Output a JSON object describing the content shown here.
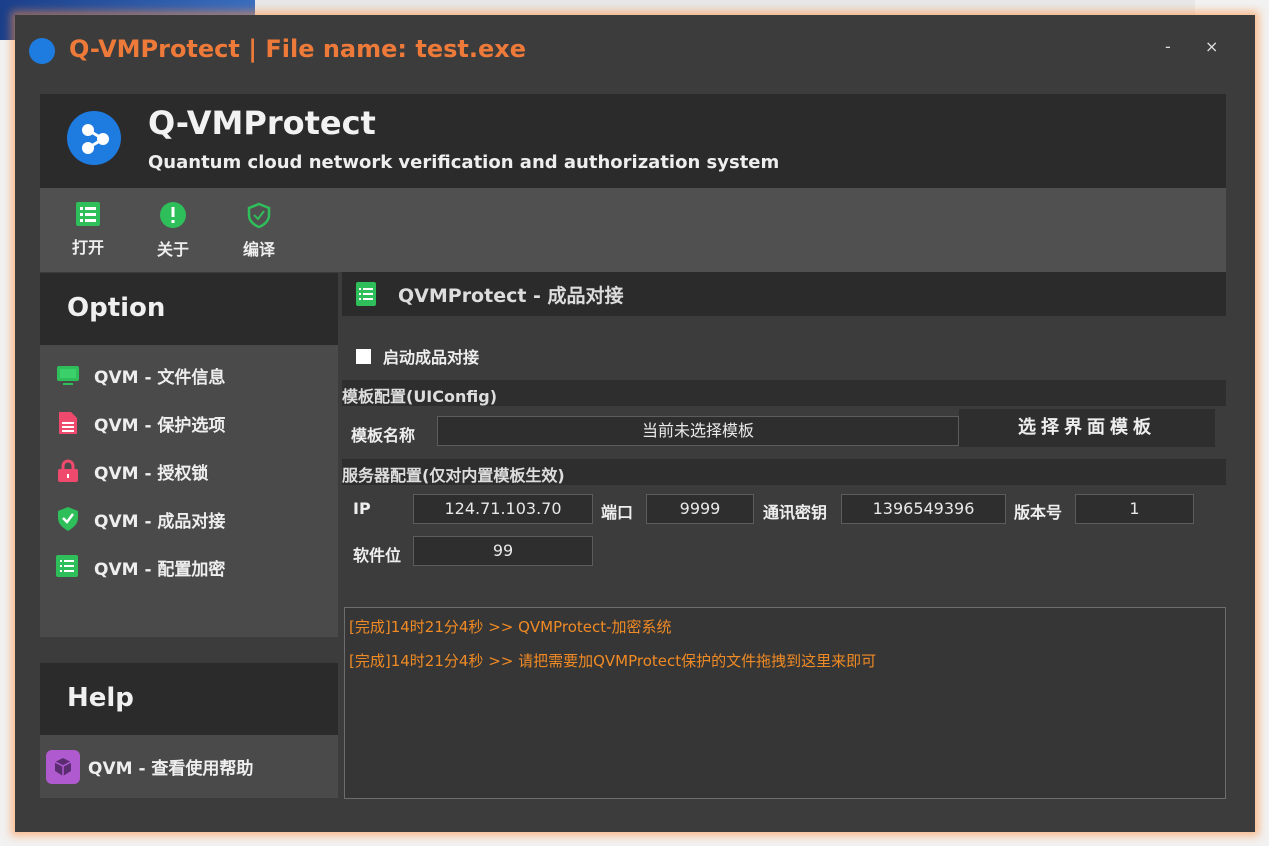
{
  "window": {
    "title": "Q-VMProtect | File name: test.exe",
    "minimize": "-",
    "close": "×"
  },
  "header": {
    "title": "Q-VMProtect",
    "subtitle": "Quantum cloud network verification and authorization system"
  },
  "toolbar": [
    {
      "label": "打开",
      "icon": "list-icon"
    },
    {
      "label": "关于",
      "icon": "alert-icon"
    },
    {
      "label": "编译",
      "icon": "shield-check-icon"
    }
  ],
  "sidebar": {
    "option_title": "Option",
    "items": [
      {
        "label": "QVM - 文件信息",
        "icon": "monitor-icon",
        "color": "#2fbf5a"
      },
      {
        "label": "QVM - 保护选项",
        "icon": "document-icon",
        "color": "#ef4a6e"
      },
      {
        "label": "QVM - 授权锁",
        "icon": "lock-icon",
        "color": "#ef4a6e"
      },
      {
        "label": "QVM - 成品对接",
        "icon": "shield-check-icon",
        "color": "#2fbf5a"
      },
      {
        "label": "QVM - 配置加密",
        "icon": "list-icon",
        "color": "#2fbf5a"
      }
    ],
    "help_title": "Help",
    "help_item": "QVM - 查看使用帮助"
  },
  "main": {
    "title": "QVMProtect - 成品对接",
    "checkbox": "启动成品对接",
    "template_section": "模板配置(UIConfig)",
    "template_name_label": "模板名称",
    "template_name_value": "当前未选择模板",
    "select_template_button": "选择界面模板",
    "server_section": "服务器配置(仅对内置模板生效)",
    "ip_label": "IP",
    "ip": "124.71.103.70",
    "port_label": "端口",
    "port": "9999",
    "key_label": "通讯密钥",
    "key": "1396549396",
    "version_label": "版本号",
    "version": "1",
    "software_label": "软件位",
    "software": "99",
    "log": [
      "[完成]14时21分4秒 >> QVMProtect-加密系统",
      "[完成]14时21分4秒 >> 请把需要加QVMProtect保护的文件拖拽到这里来即可"
    ]
  }
}
